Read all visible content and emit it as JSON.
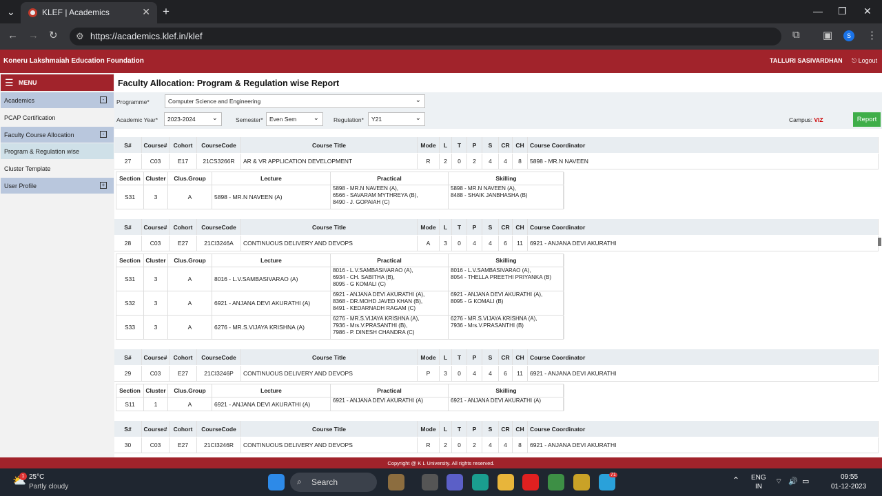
{
  "browser": {
    "tab_title": "KLEF | Academics",
    "url": "https://academics.klef.in/klef",
    "profile_initial": "S"
  },
  "header": {
    "brand": "Koneru Lakshmaiah Education Foundation",
    "user": "TALLURI SASIVARDHAN",
    "logout": "Logout"
  },
  "sidebar": {
    "menu": "MENU",
    "items": [
      {
        "label": "Academics",
        "toggle": "-"
      },
      {
        "label": "PCAP Certification"
      },
      {
        "label": "Faculty Course Allocation",
        "toggle": "-"
      },
      {
        "label": "Program & Regulation wise"
      },
      {
        "label": "Cluster Template"
      },
      {
        "label": "User Profile",
        "toggle": "+"
      }
    ]
  },
  "page": {
    "title": "Faculty Allocation: Program & Regulation wise Report"
  },
  "filters": {
    "programme_label": "Programme*",
    "programme": "Computer Science and Engineering",
    "year_label": "Academic Year*",
    "year": "2023-2024",
    "semester_label": "Semester*",
    "semester": "Even Sem",
    "regulation_label": "Regulation*",
    "regulation": "Y21",
    "campus_label": "Campus:",
    "campus": "VIZ",
    "report": "Report"
  },
  "course_headers": [
    "S#",
    "Course#",
    "Cohort",
    "CourseCode",
    "Course Title",
    "Mode",
    "L",
    "T",
    "P",
    "S",
    "CR",
    "CH",
    "Course Coordinator"
  ],
  "section_headers": [
    "Section",
    "Cluster",
    "Clus.Group",
    "Lecture",
    "Practical",
    "Skilling"
  ],
  "courses": [
    {
      "sno": "27",
      "course": "C03",
      "cohort": "E17",
      "code": "21CS3266R",
      "title": "AR & VR APPLICATION DEVELOPMENT",
      "mode": "R",
      "l": "2",
      "t": "0",
      "p": "2",
      "s": "4",
      "cr": "4",
      "ch": "8",
      "coord": "5898 - MR.N NAVEEN",
      "sections": [
        {
          "sec": "S31",
          "cluster": "3",
          "group": "A",
          "lecture": "5898 - MR.N NAVEEN (A)",
          "practical": [
            "5898 - MR.N NAVEEN (A),",
            "6566 - SAVARAM MYTHREYA (B),",
            "8490 - J. GOPAIAH (C)"
          ],
          "skilling": [
            "5898 - MR.N NAVEEN (A),",
            "8488 - SHAIK JANBHASHA (B)"
          ]
        }
      ]
    },
    {
      "sno": "28",
      "course": "C03",
      "cohort": "E27",
      "code": "21CI3246A",
      "title": "CONTINUOUS DELIVERY AND DEVOPS",
      "mode": "A",
      "l": "3",
      "t": "0",
      "p": "4",
      "s": "4",
      "cr": "6",
      "ch": "11",
      "coord": "6921 - ANJANA DEVI AKURATHI",
      "sections": [
        {
          "sec": "S31",
          "cluster": "3",
          "group": "A",
          "lecture": "8016 - L.V.SAMBASIVARAO (A)",
          "practical": [
            "8016 - L.V.SAMBASIVARAO (A),",
            "6934 - CH. SABITHA (B),",
            "8095 - G KOMALI (C)"
          ],
          "skilling": [
            "8016 - L.V.SAMBASIVARAO (A),",
            "8054 - THELLA PREETHI PRIYANKA (B)"
          ]
        },
        {
          "sec": "S32",
          "cluster": "3",
          "group": "A",
          "lecture": "6921 - ANJANA DEVI AKURATHI (A)",
          "practical": [
            "6921 - ANJANA DEVI AKURATHI (A),",
            "8368 - DR.MOHD JAVED KHAN (B),",
            "8491 - KEDARNADH RAGAM (C)"
          ],
          "skilling": [
            "6921 - ANJANA DEVI AKURATHI (A),",
            "8095 - G KOMALI (B)"
          ]
        },
        {
          "sec": "S33",
          "cluster": "3",
          "group": "A",
          "lecture": "6276 - MR.S.VIJAYA KRISHNA (A)",
          "practical": [
            "6276 - MR.S.VIJAYA KRISHNA (A),",
            "7936 - Mrs.V.PRASANTHI (B),",
            "7986 - P. DINESH CHANDRA (C)"
          ],
          "skilling": [
            "6276 - MR.S.VIJAYA KRISHNA (A),",
            "7936 - Mrs.V.PRASANTHI (B)"
          ]
        }
      ]
    },
    {
      "sno": "29",
      "course": "C03",
      "cohort": "E27",
      "code": "21CI3246P",
      "title": "CONTINUOUS DELIVERY AND DEVOPS",
      "mode": "P",
      "l": "3",
      "t": "0",
      "p": "4",
      "s": "4",
      "cr": "6",
      "ch": "11",
      "coord": "6921 - ANJANA DEVI AKURATHI",
      "sections": [
        {
          "sec": "S11",
          "cluster": "1",
          "group": "A",
          "lecture": "6921 - ANJANA DEVI AKURATHI (A)",
          "practical": [
            "6921 - ANJANA DEVI AKURATHI (A)"
          ],
          "skilling": [
            "6921 - ANJANA DEVI AKURATHI (A)"
          ]
        }
      ]
    },
    {
      "sno": "30",
      "course": "C03",
      "cohort": "E27",
      "code": "21CI3246R",
      "title": "CONTINUOUS DELIVERY AND DEVOPS",
      "mode": "R",
      "l": "2",
      "t": "0",
      "p": "2",
      "s": "4",
      "cr": "4",
      "ch": "8",
      "coord": "6921 - ANJANA DEVI AKURATHI",
      "sections": []
    }
  ],
  "footer": "Copyright @ K L University. All rights reserved.",
  "taskbar": {
    "temp": "25°C",
    "weather": "Partly cloudy",
    "weather_badge": "1",
    "search": "Search",
    "lang1": "ENG",
    "lang2": "IN",
    "time": "09:55",
    "date": "01-12-2023",
    "telegram_badge": "71"
  }
}
